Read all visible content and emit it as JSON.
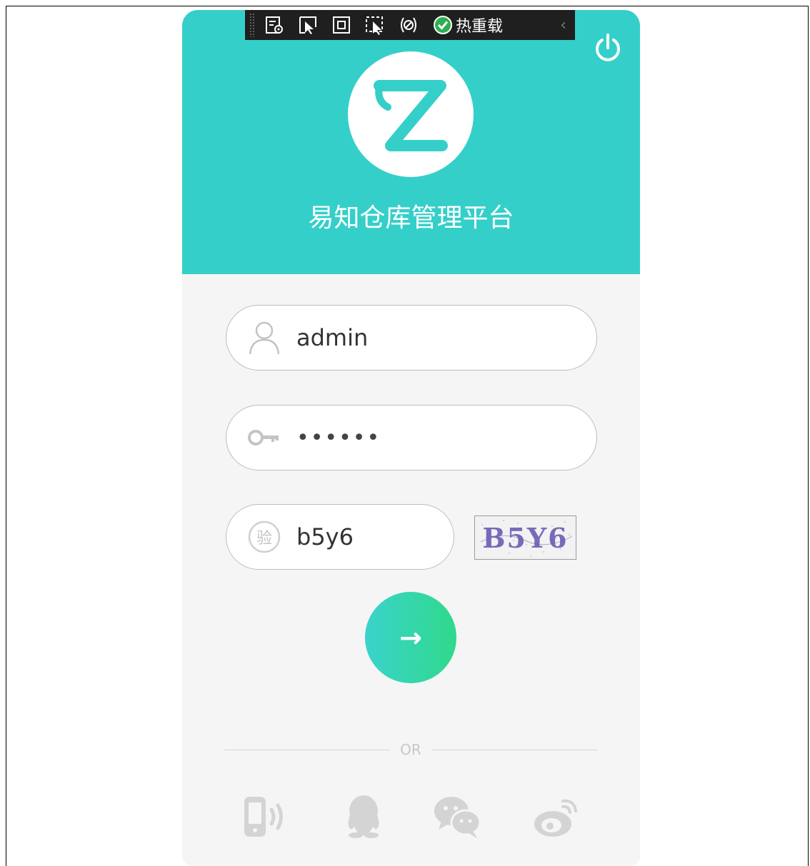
{
  "toolbar": {
    "hot_reload_label": "热重载",
    "chevron": "‹",
    "icons": [
      "live-visual-tree-icon",
      "select-element-icon",
      "display-layout-adorners-icon",
      "track-focused-element-icon",
      "binding-failures-icon",
      "check-circle-icon"
    ]
  },
  "header": {
    "title": "易知仓库管理平台",
    "brand_color": "#35cfc9",
    "logo_letter": "Z"
  },
  "form": {
    "username_value": "admin",
    "password_value": "••••••",
    "captcha_badge": "验",
    "captcha_value": "b5y6",
    "captcha_image_text": "B5Y6",
    "submit_symbol": "→"
  },
  "divider": {
    "label": "OR"
  },
  "social": {
    "items": [
      "phone-login-icon",
      "qq-icon",
      "wechat-icon",
      "weibo-icon"
    ]
  },
  "colors": {
    "accent": "#35cfc9",
    "button_gradient_start": "#3ad3cc",
    "button_gradient_end": "#2fd98b",
    "social_icon": "#d4d4d4"
  }
}
